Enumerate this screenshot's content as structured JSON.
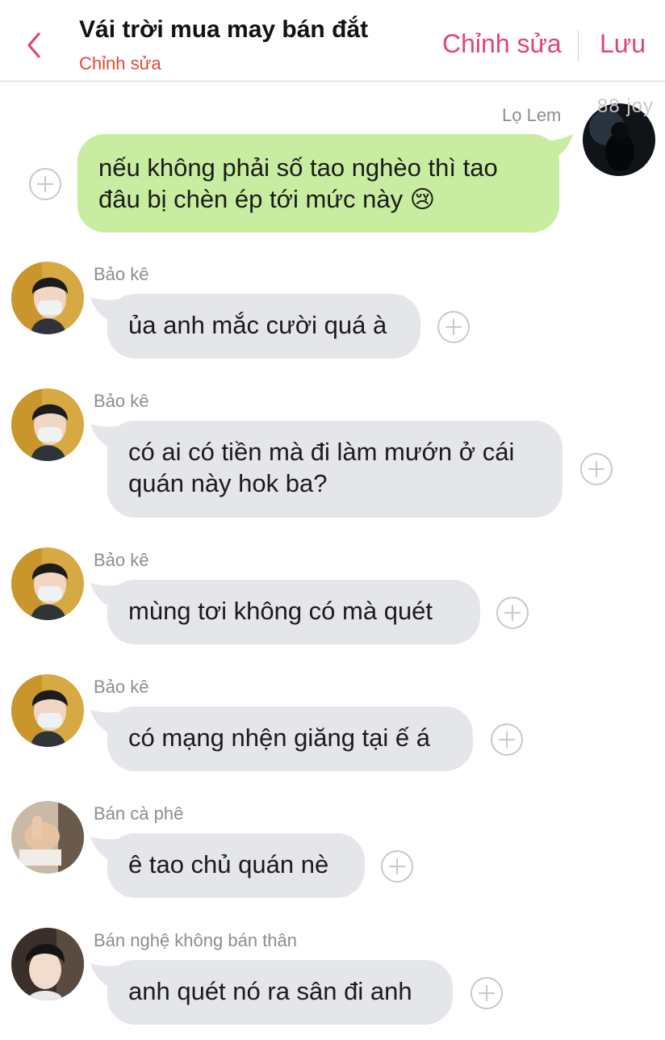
{
  "header": {
    "title": "Vái trời mua may bán đắt",
    "subtitle": "Chỉnh sửa",
    "edit_label": "Chỉnh sửa",
    "save_label": "Lưu"
  },
  "messages": [
    {
      "sender": "Lọ Lem",
      "direction": "out",
      "text": "nếu không phải số tao nghèo thì tao đâu bị chèn ép tới mức này",
      "emoji": "😢"
    },
    {
      "sender": "Bảo kê",
      "direction": "in",
      "text": "ủa anh mắc cười quá à"
    },
    {
      "sender": "Bảo kê",
      "direction": "in",
      "text": "có ai có tiền mà đi làm mướn ở cái quán này hok ba?"
    },
    {
      "sender": "Bảo kê",
      "direction": "in",
      "text": "mùng tơi không có mà quét"
    },
    {
      "sender": "Bảo kê",
      "direction": "in",
      "text": "có mạng nhện giăng tại ế á"
    },
    {
      "sender": "Bán cà phê",
      "direction": "in",
      "text": "ê tao chủ quán nè"
    },
    {
      "sender": "Bán nghệ không bán thân",
      "direction": "in",
      "text": "anh quét nó ra sân đi anh"
    }
  ],
  "avatar_overlay_text": "88 joy",
  "colors": {
    "accent": "#e0457a",
    "subtitle": "#e2493a",
    "bubble_in": "#e4e6ea",
    "bubble_out": "#c8eda0"
  }
}
